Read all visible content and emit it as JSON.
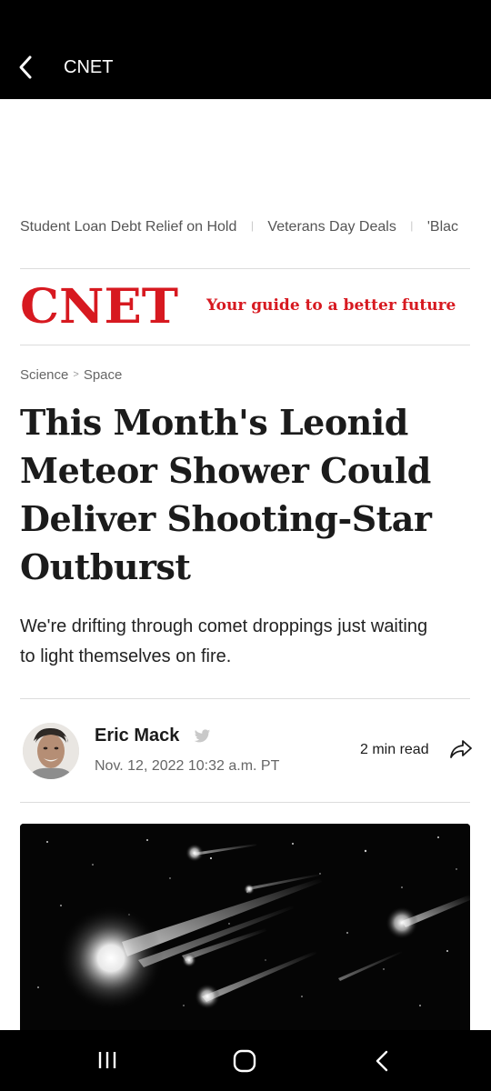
{
  "app_bar": {
    "title": "CNET",
    "back_icon": "chevron-left-icon"
  },
  "trending": {
    "items": [
      "Student Loan Debt Relief on Hold",
      "Veterans Day Deals",
      "'Blac"
    ],
    "separator": "|"
  },
  "brand": {
    "logo_text": "CNET",
    "tagline": "Your guide to a better future",
    "color": "#d71920"
  },
  "breadcrumb": {
    "section": "Science",
    "separator": ">",
    "subsection": "Space"
  },
  "article": {
    "headline": "This Month's Leonid Meteor Shower Could Deliver Shooting-Star Outburst",
    "dek": "We're drifting through comet droppings just waiting to light themselves on fire.",
    "author": "Eric Mack",
    "date": "Nov. 12, 2022 10:32 a.m. PT",
    "read_time": "2 min read",
    "share_icon": "share-icon",
    "twitter_icon": "twitter-icon",
    "hero_image": "meteor-shower-photo"
  },
  "system_nav": {
    "recents_icon": "recents-icon",
    "home_icon": "home-icon",
    "back_icon": "back-icon"
  }
}
